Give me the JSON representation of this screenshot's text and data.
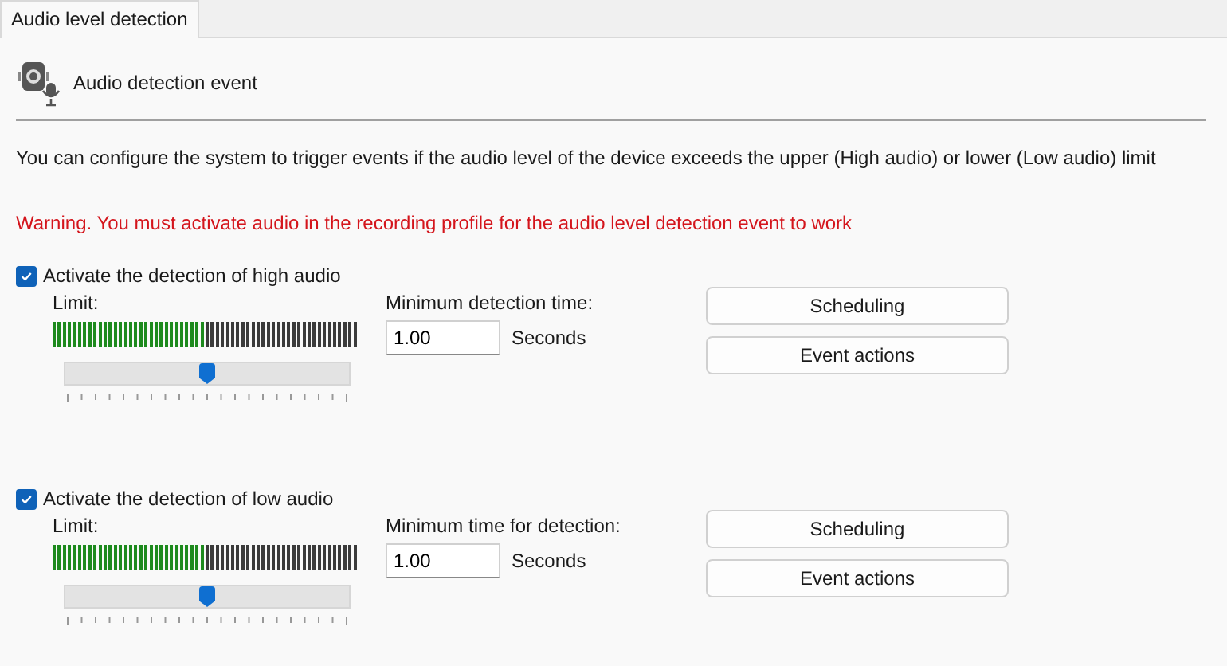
{
  "tabs": [
    {
      "label": "Audio level detection",
      "selected": true
    }
  ],
  "header": {
    "title": "Audio detection event"
  },
  "description": "You can configure the system to trigger events if the audio level of the device exceeds the upper (High audio) or lower (Low audio) limit",
  "warning": "Warning. You must activate audio in the recording profile for the audio level detection event to work",
  "sections": [
    {
      "checkbox": {
        "label": "Activate the detection of high audio",
        "checked": true
      },
      "limit_label": "Limit:",
      "meter": {
        "level": 0.5
      },
      "slider": {
        "level": 0.5
      },
      "time_label": "Minimum detection time:",
      "time_value": "1.00",
      "unit": "Seconds",
      "buttons": [
        "Scheduling",
        "Event actions"
      ]
    },
    {
      "checkbox": {
        "label": "Activate the detection of low audio",
        "checked": true
      },
      "limit_label": "Limit:",
      "meter": {
        "level": 0.5
      },
      "slider": {
        "level": 0.5
      },
      "time_label": "Minimum time for detection:",
      "time_value": "1.00",
      "unit": "Seconds",
      "buttons": [
        "Scheduling",
        "Event actions"
      ]
    }
  ]
}
